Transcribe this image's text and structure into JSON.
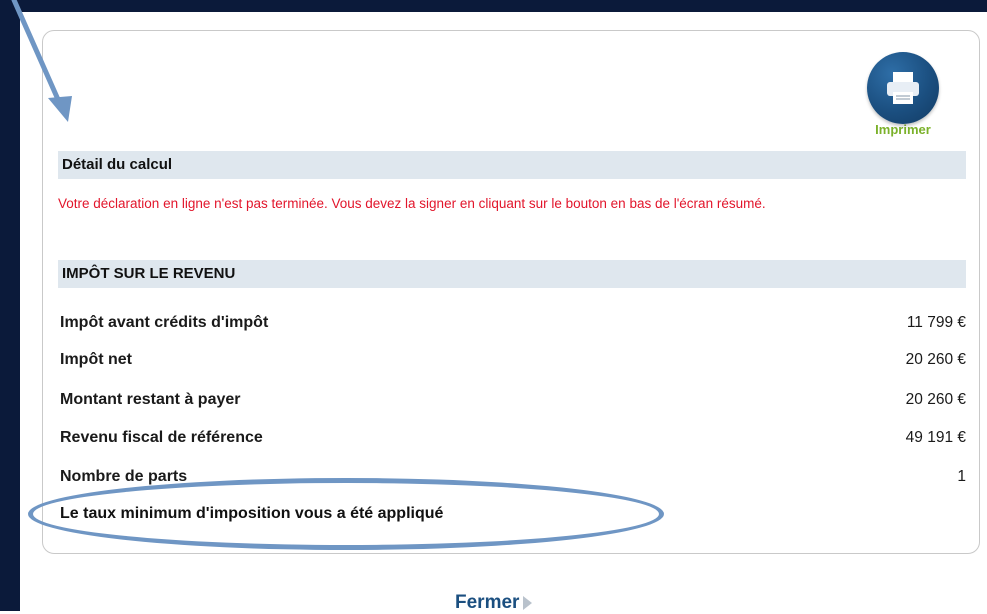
{
  "print": {
    "icon": "printer-icon",
    "label": "Imprimer"
  },
  "sections": {
    "detail_title": "Détail du calcul",
    "warning": "Votre déclaration en ligne n'est pas terminée. Vous devez la signer en cliquant sur le bouton en bas de l'écran résumé.",
    "impot_title": "IMPÔT SUR LE REVENU"
  },
  "rows": [
    {
      "label": "Impôt avant crédits d'impôt",
      "value": "11 799 €"
    },
    {
      "label": "Impôt net",
      "value": "20 260 €"
    },
    {
      "label": "Montant restant à payer",
      "value": "20 260 €"
    },
    {
      "label": "Revenu fiscal de référence",
      "value": "49 191 €"
    },
    {
      "label": "Nombre de parts",
      "value": "1"
    }
  ],
  "note": "Le taux minimum d'imposition vous a été appliqué",
  "footer": {
    "close_label": "Fermer"
  },
  "colors": {
    "annotation": "#6f96c4",
    "warning": "#e2152b",
    "section_bg": "#dfe7ee",
    "print_label": "#7bb12a"
  }
}
